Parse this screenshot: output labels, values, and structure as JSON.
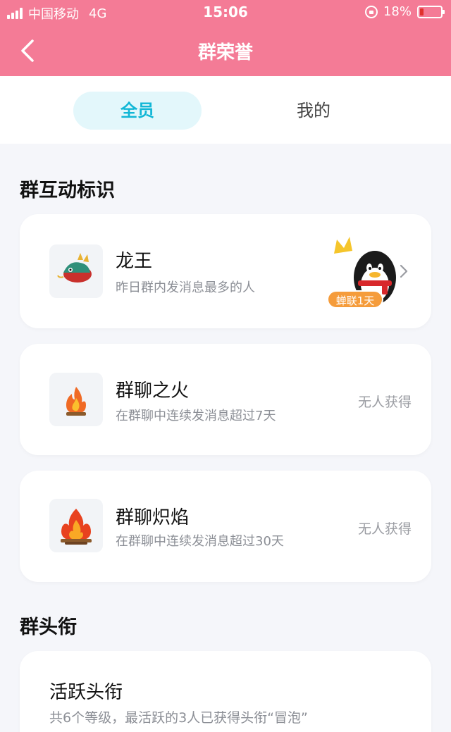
{
  "status_bar": {
    "carrier": "中国移动",
    "network": "4G",
    "time": "15:06",
    "battery_percent": "18%",
    "battery_level": 0.18,
    "battery_color": "#e0312c"
  },
  "nav": {
    "title": "群荣誉",
    "back_icon": "chevron-left-icon"
  },
  "tabs": [
    {
      "label": "全员",
      "active": true
    },
    {
      "label": "我的",
      "active": false
    }
  ],
  "sections": {
    "interaction_title": "群互动标识",
    "title_section": "群头衔"
  },
  "honors": [
    {
      "name": "龙王",
      "desc": "昨日群内发消息最多的人",
      "icon": "dragon-icon",
      "holder_badge": "蝉联1天"
    },
    {
      "name": "群聊之火",
      "desc": "在群聊中连续发消息超过7天",
      "icon": "fire-icon",
      "status": "无人获得"
    },
    {
      "name": "群聊炽焰",
      "desc": "在群聊中连续发消息超过30天",
      "icon": "blaze-icon",
      "status": "无人获得"
    }
  ],
  "active_title": {
    "name": "活跃头衔",
    "desc": "共6个等级，最活跃的3人已获得头衔“冒泡”"
  },
  "colors": {
    "header": "#f47b96",
    "tab_active_bg": "#e3f7fb",
    "tab_active_text": "#12b7d6",
    "badge": "#f59c3b"
  }
}
